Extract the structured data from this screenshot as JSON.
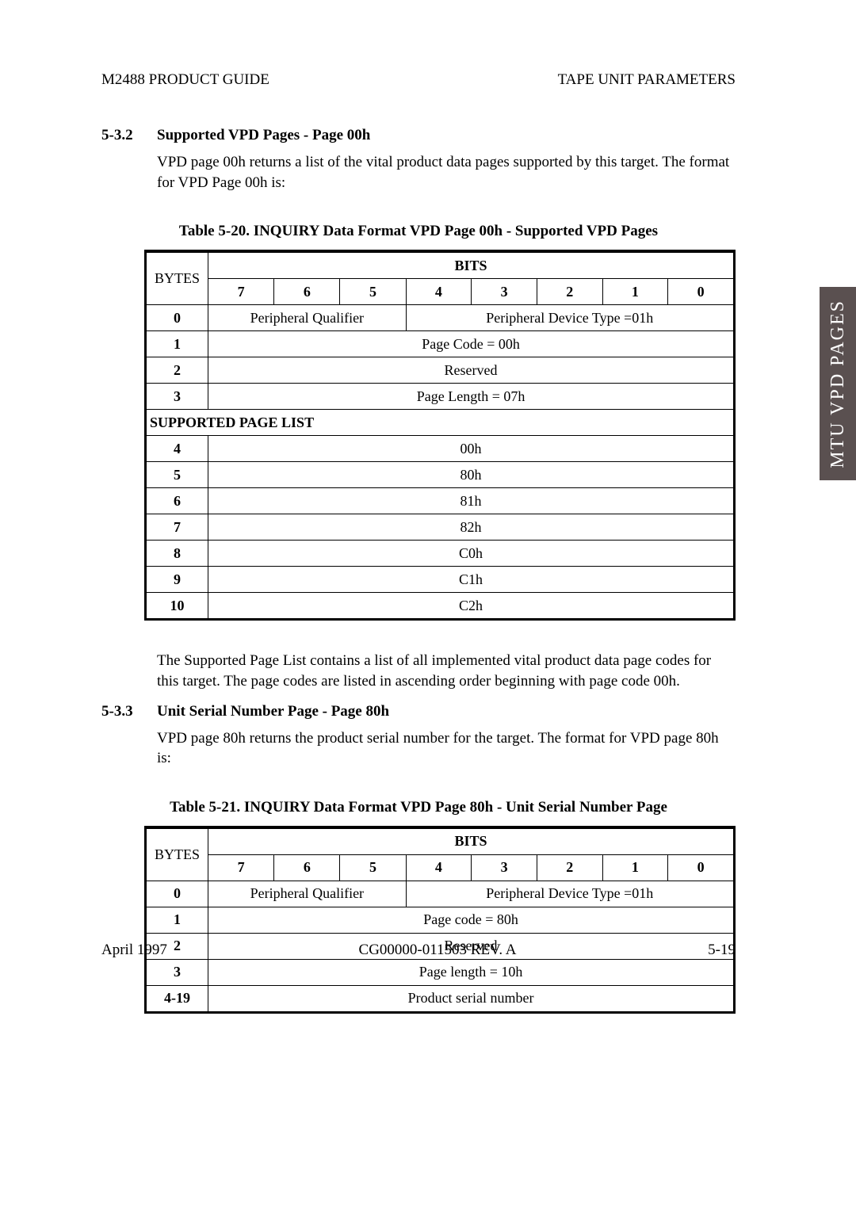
{
  "header": {
    "left": "M2488 PRODUCT GUIDE",
    "right": "TAPE UNIT PARAMETERS"
  },
  "side_tab": "MTU VPD PAGES",
  "sec1": {
    "num": "5-3.2",
    "title": "Supported VPD Pages - Page 00h",
    "para": "VPD page 00h returns a list of the vital product data pages supported by this target. The format for VPD Page 00h is:"
  },
  "table1": {
    "caption": "Table 5-20.   INQUIRY Data Format VPD Page 00h - Supported VPD Pages",
    "bits_label": "BITS",
    "bytes_label": "BYTES",
    "bit_cols": [
      "7",
      "6",
      "5",
      "4",
      "3",
      "2",
      "1",
      "0"
    ],
    "rows": {
      "b0": "0",
      "pq": "Peripheral Qualifier",
      "pdt": "Peripheral Device Type =01h",
      "b1": "1",
      "r1": "Page Code = 00h",
      "b2": "2",
      "r2": "Reserved",
      "b3": "3",
      "r3": "Page Length = 07h",
      "spl": "SUPPORTED PAGE LIST",
      "b4": "4",
      "r4": "00h",
      "b5": "5",
      "r5": "80h",
      "b6": "6",
      "r6": "81h",
      "b7": "7",
      "r7": "82h",
      "b8": "8",
      "r8": "C0h",
      "b9": "9",
      "r9": "C1h",
      "b10": "10",
      "r10": "C2h"
    }
  },
  "para_after_t1": "The Supported Page List  contains a list of all implemented vital product data page codes for this target.  The page codes are listed in ascending order beginning with page code 00h.",
  "sec2": {
    "num": "5-3.3",
    "title": "Unit Serial Number Page - Page 80h",
    "para": "VPD page 80h returns the product serial number for the target. The format for VPD page 80h is:"
  },
  "table2": {
    "caption": "Table 5-21.   INQUIRY Data Format VPD Page 80h - Unit Serial Number Page",
    "bits_label": "BITS",
    "bytes_label": "BYTES",
    "bit_cols": [
      "7",
      "6",
      "5",
      "4",
      "3",
      "2",
      "1",
      "0"
    ],
    "rows": {
      "b0": "0",
      "pq": "Peripheral Qualifier",
      "pdt": "Peripheral Device Type =01h",
      "b1": "1",
      "r1": "Page code  = 80h",
      "b2": "2",
      "r2": "Reserved",
      "b3": "3",
      "r3": "Page length  = 10h",
      "b4": "4-19",
      "r4": "Product serial number"
    }
  },
  "footer": {
    "left": "April 1997",
    "center": "CG00000-011503 REV. A",
    "right": "5-19"
  }
}
